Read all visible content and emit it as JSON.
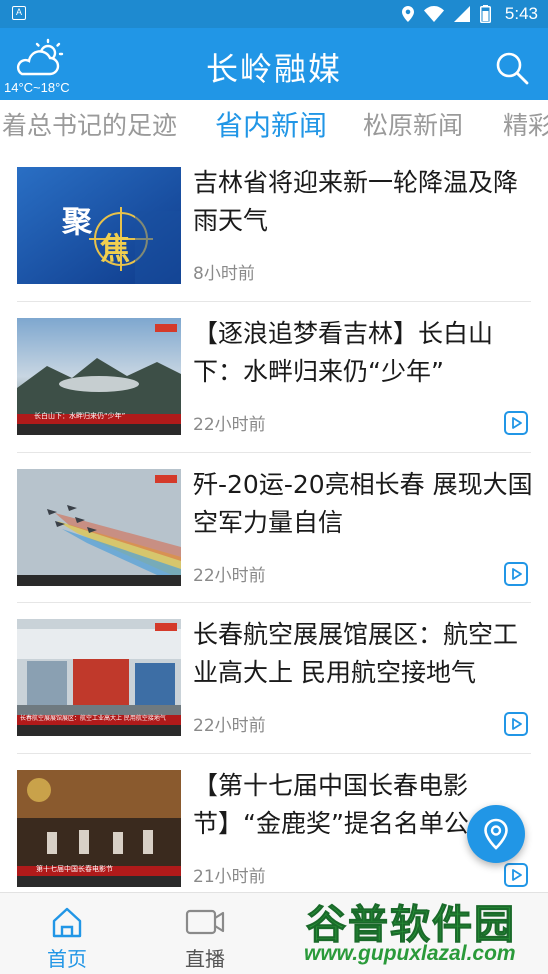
{
  "status_bar": {
    "app_badge": "A",
    "time": "5:43"
  },
  "header": {
    "weather_temp": "14°C~18°C",
    "title": "长岭融媒"
  },
  "tabs": [
    {
      "label": "着总书记的足迹",
      "active": false
    },
    {
      "label": "省内新闻",
      "active": true
    },
    {
      "label": "松原新闻",
      "active": false
    },
    {
      "label": "精彩",
      "active": false
    }
  ],
  "news": [
    {
      "headline": "吉林省将迎来新一轮降温及降雨天气",
      "time": "8小时前",
      "is_video": false,
      "thumb_caption": "聚焦"
    },
    {
      "headline": "【逐浪追梦看吉林】长白山下：水畔归来仍“少年”",
      "time": "22小时前",
      "is_video": true,
      "thumb_caption": "长白山下：水畔归来仍“少年”"
    },
    {
      "headline": "歼-20运-20亮相长春 展现大国空军力量自信",
      "time": "22小时前",
      "is_video": true,
      "thumb_caption": ""
    },
    {
      "headline": "长春航空展展馆展区：航空工业高大上 民用航空接地气",
      "time": "22小时前",
      "is_video": true,
      "thumb_caption": "长春航空展展馆展区：航空工业高大上 民用航空接地气"
    },
    {
      "headline": "【第十七届中国长春电影节】“金鹿奖”提名名单公",
      "time": "21小时前",
      "is_video": true,
      "thumb_caption": "第十七届中国长春电影节"
    }
  ],
  "bottom_nav": [
    {
      "label": "首页",
      "active": true,
      "icon": "home-icon"
    },
    {
      "label": "直播",
      "active": false,
      "icon": "live-camera-icon"
    }
  ],
  "watermark": {
    "top": "谷普软件园",
    "bottom": "www.gupuxlazal.com"
  },
  "colors": {
    "accent": "#2196e6",
    "status_bar": "#1e8ad0",
    "text": "#1a1a1a",
    "muted": "#8a8a8a",
    "watermark": "#2a9a3a"
  }
}
